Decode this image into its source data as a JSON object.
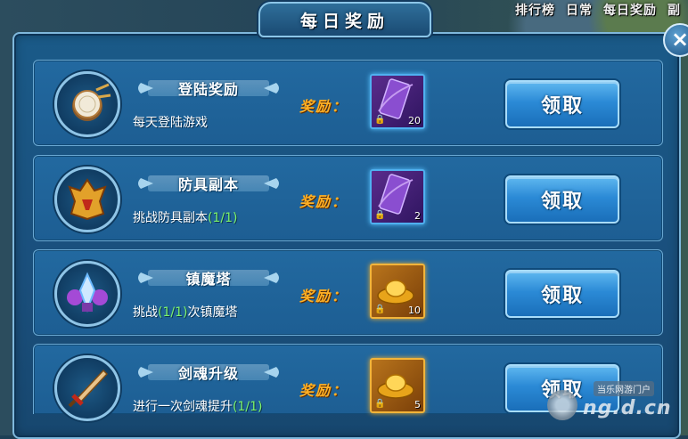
{
  "top_nav": [
    "排行榜",
    "日常",
    "每日奖励",
    "副"
  ],
  "window": {
    "title": "每日奖励",
    "close_label": "×"
  },
  "reward_label": "奖励：",
  "claim_label": "领取",
  "tasks": [
    {
      "name": "登陆奖励",
      "desc_parts": [
        "每天登陆游戏",
        "",
        ""
      ],
      "icon": "drum-icon",
      "reward": {
        "icon": "purple-scroll-icon",
        "count": "20",
        "locked": true
      }
    },
    {
      "name": "防具副本",
      "desc_parts": [
        "挑战防具副本",
        "(1/1)",
        ""
      ],
      "icon": "helmet-icon",
      "reward": {
        "icon": "purple-scroll-icon",
        "count": "2",
        "locked": true
      }
    },
    {
      "name": "镇魔塔",
      "desc_parts": [
        "挑战",
        "(1/1)",
        "次镇魔塔"
      ],
      "icon": "crystal-tower-icon",
      "reward": {
        "icon": "gold-ingot-icon",
        "count": "10",
        "locked": true
      }
    },
    {
      "name": "剑魂升级",
      "desc_parts": [
        "进行一次剑魂提升",
        "(1/1)",
        ""
      ],
      "icon": "sword-icon",
      "reward": {
        "icon": "gold-ingot-icon",
        "count": "5",
        "locked": true
      }
    }
  ],
  "watermark": {
    "main": "ng.d.cn",
    "sub": "当乐网游门户"
  }
}
